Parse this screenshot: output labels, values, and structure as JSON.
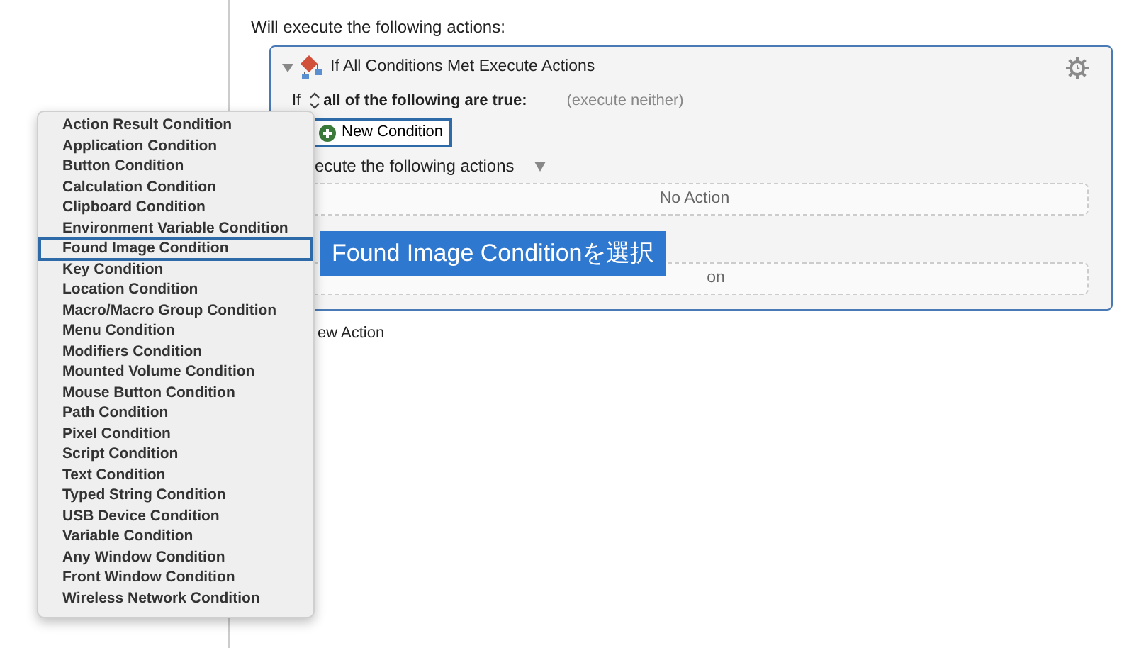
{
  "intro": "Will execute the following actions:",
  "action": {
    "expanded": true,
    "title": "If All Conditions Met Execute Actions",
    "if_label": "If",
    "mode": "all of the following are true:",
    "note": "(execute neither)",
    "new_condition_button": "New Condition",
    "then_label": "ecute the following actions",
    "then_action": "No Action",
    "else_action": "on"
  },
  "new_action": "ew Action",
  "menu": {
    "items": [
      {
        "label": "Action Result Condition",
        "selected": false
      },
      {
        "label": "Application Condition",
        "selected": false
      },
      {
        "label": "Button Condition",
        "selected": false
      },
      {
        "label": "Calculation Condition",
        "selected": false
      },
      {
        "label": "Clipboard Condition",
        "selected": false
      },
      {
        "label": "Environment Variable Condition",
        "selected": false
      },
      {
        "label": "Found Image Condition",
        "selected": true
      },
      {
        "label": "Key Condition",
        "selected": false
      },
      {
        "label": "Location Condition",
        "selected": false
      },
      {
        "label": "Macro/Macro Group Condition",
        "selected": false
      },
      {
        "label": "Menu Condition",
        "selected": false
      },
      {
        "label": "Modifiers Condition",
        "selected": false
      },
      {
        "label": "Mounted Volume Condition",
        "selected": false
      },
      {
        "label": "Mouse Button Condition",
        "selected": false
      },
      {
        "label": "Path Condition",
        "selected": false
      },
      {
        "label": "Pixel Condition",
        "selected": false
      },
      {
        "label": "Script Condition",
        "selected": false
      },
      {
        "label": "Text Condition",
        "selected": false
      },
      {
        "label": "Typed String Condition",
        "selected": false
      },
      {
        "label": "USB Device Condition",
        "selected": false
      },
      {
        "label": "Variable Condition",
        "selected": false
      },
      {
        "label": "Any Window Condition",
        "selected": false
      },
      {
        "label": "Front Window Condition",
        "selected": false
      },
      {
        "label": "Wireless Network Condition",
        "selected": false
      }
    ]
  },
  "callout": {
    "text": "Found Image Conditionを選択"
  }
}
